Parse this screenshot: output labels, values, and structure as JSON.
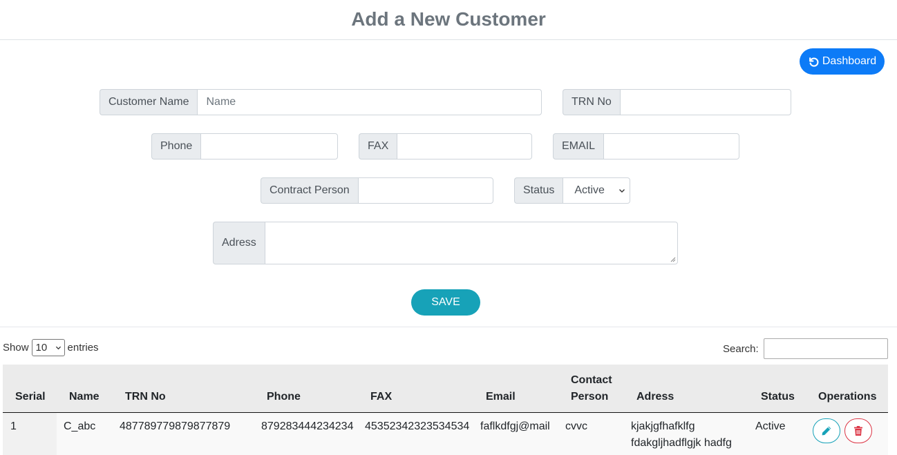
{
  "title": "Add a New Customer",
  "dashboard_button": {
    "label": "Dashboard",
    "icon": "undo-icon"
  },
  "form": {
    "customer_name": {
      "label": "Customer Name",
      "placeholder": "Name"
    },
    "trn_no": {
      "label": "TRN No",
      "placeholder": ""
    },
    "phone": {
      "label": "Phone",
      "placeholder": ""
    },
    "fax": {
      "label": "FAX",
      "placeholder": ""
    },
    "email": {
      "label": "EMAIL",
      "placeholder": ""
    },
    "contract_person": {
      "label": "Contract Person",
      "placeholder": ""
    },
    "status": {
      "label": "Status",
      "selected": "Active"
    },
    "adress": {
      "label": "Adress",
      "placeholder": ""
    },
    "save_label": "SAVE"
  },
  "table_controls": {
    "show_prefix": "Show",
    "show_value": "10",
    "show_suffix": "entries",
    "search_label": "Search:"
  },
  "table": {
    "headers": {
      "serial": "Serial",
      "name": "Name",
      "trn_no": "TRN No",
      "phone": "Phone",
      "fax": "FAX",
      "email": "Email",
      "contact_person_1": "Contact",
      "contact_person_2": "Person",
      "adress": "Adress",
      "status": "Status",
      "operations": "Operations"
    },
    "rows": [
      {
        "serial": "1",
        "name": "C_abc",
        "trn_no": "487789779879877879",
        "phone": "879283444234234",
        "fax": "45352342323534534",
        "email": "faflkdfgj@mail",
        "contact_person": "cvvc",
        "adress_line1": "kjakjgfhafklfg",
        "adress_line2": "fdakgljhadflgjk hadfg",
        "status": "Active"
      }
    ]
  },
  "colors": {
    "primary": "#0d7bf7",
    "info": "#17a2b8",
    "danger": "#dc3545",
    "title": "#6c757d"
  }
}
